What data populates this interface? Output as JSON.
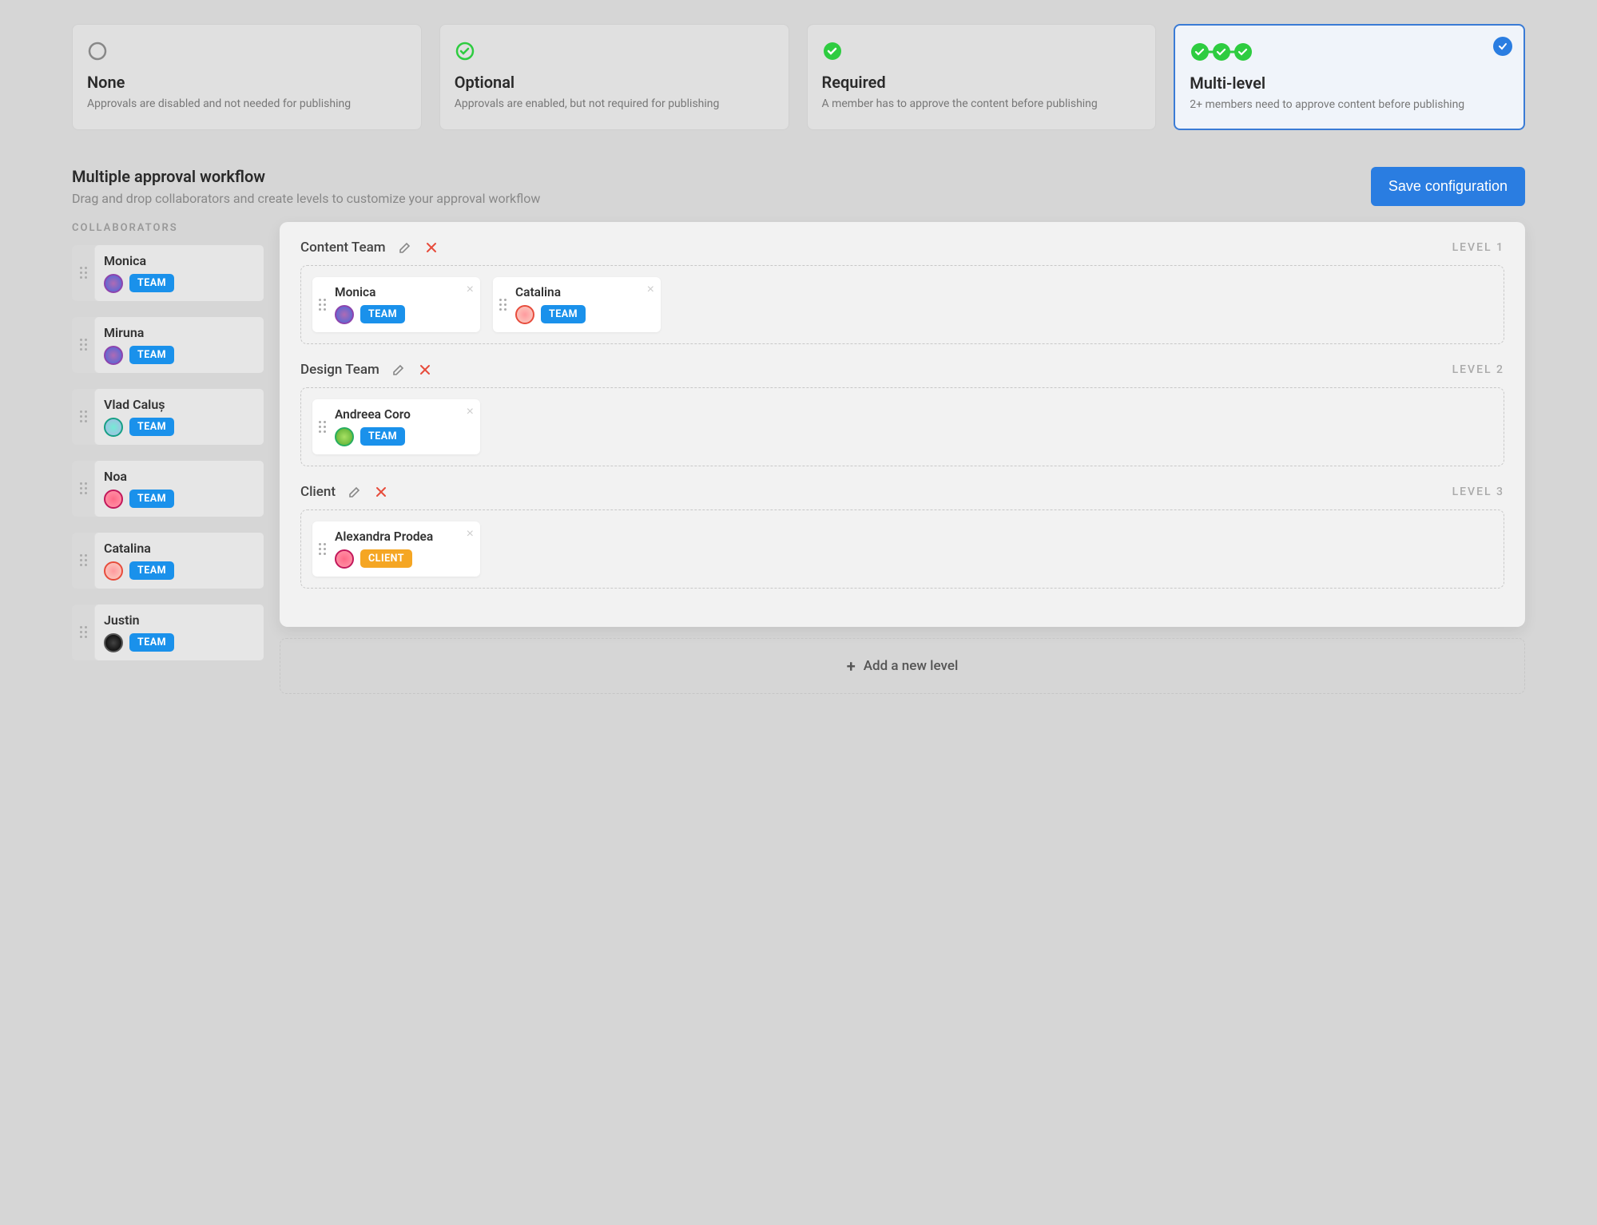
{
  "options": [
    {
      "title": "None",
      "desc": "Approvals are disabled and not needed for publishing",
      "selected": false,
      "icon": "circle"
    },
    {
      "title": "Optional",
      "desc": "Approvals are enabled, but not required for publishing",
      "selected": false,
      "icon": "check-outline"
    },
    {
      "title": "Required",
      "desc": "A member has to approve the content before publishing",
      "selected": false,
      "icon": "check-badge"
    },
    {
      "title": "Multi-level",
      "desc": "2+ members need to approve content before publishing",
      "selected": true,
      "icon": "multi-check"
    }
  ],
  "section": {
    "title": "Multiple approval workflow",
    "subtitle": "Drag and drop collaborators and create levels to customize your approval workflow",
    "save_label": "Save configuration",
    "collab_label": "COLLABORATORS",
    "add_level_label": "Add a new level"
  },
  "collaborators": [
    {
      "name": "Monica",
      "role": "TEAM",
      "avatar": "av-purple"
    },
    {
      "name": "Miruna",
      "role": "TEAM",
      "avatar": "av-purple"
    },
    {
      "name": "Vlad Caluș",
      "role": "TEAM",
      "avatar": "av-teal"
    },
    {
      "name": "Noa",
      "role": "TEAM",
      "avatar": "av-pink"
    },
    {
      "name": "Catalina",
      "role": "TEAM",
      "avatar": "av-red"
    },
    {
      "name": "Justin",
      "role": "TEAM",
      "avatar": "av-dark"
    }
  ],
  "levels": [
    {
      "title": "Content Team",
      "label": "LEVEL 1",
      "members": [
        {
          "name": "Monica",
          "role": "TEAM",
          "avatar": "av-purple"
        },
        {
          "name": "Catalina",
          "role": "TEAM",
          "avatar": "av-red"
        }
      ]
    },
    {
      "title": "Design Team",
      "label": "LEVEL 2",
      "members": [
        {
          "name": "Andreea Coro",
          "role": "TEAM",
          "avatar": "av-green"
        }
      ]
    },
    {
      "title": "Client",
      "label": "LEVEL 3",
      "members": [
        {
          "name": "Alexandra Prodea",
          "role": "CLIENT",
          "avatar": "av-pink"
        }
      ]
    }
  ]
}
